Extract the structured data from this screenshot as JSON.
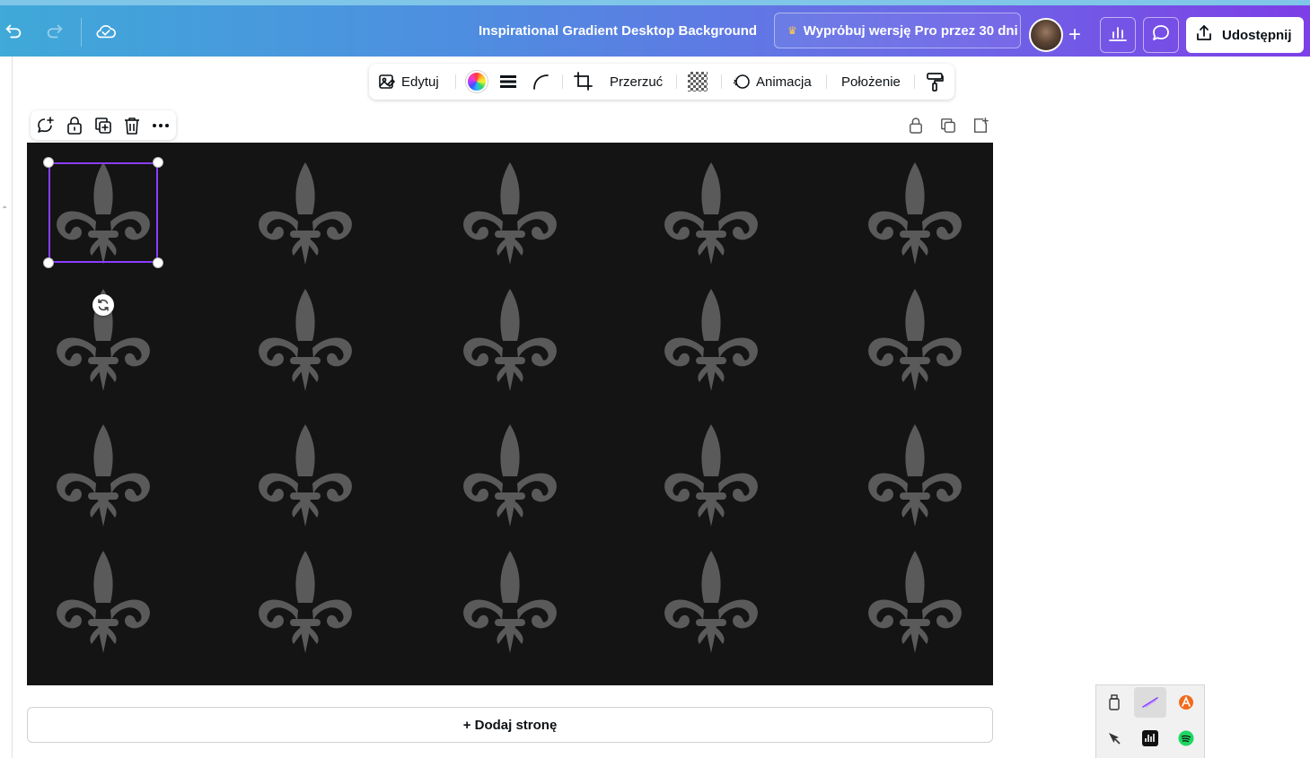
{
  "header": {
    "document_title": "Inspirational Gradient Desktop Background",
    "pro_cta_label": "Wyprόbuj wersję Pro przez 30 dni",
    "add_label": "+",
    "share_label": "Udostępnij",
    "icons": [
      "undo-icon",
      "redo-icon",
      "cloud-check-icon",
      "crown-icon",
      "bar-chart-icon",
      "comment-icon",
      "share-upload-icon"
    ]
  },
  "toolbar": {
    "edit_label": "Edytuj",
    "flip_label": "Przerzuć",
    "animate_label": "Animacja",
    "position_label": "Położenie",
    "icons": [
      "image-edit-icon",
      "color-wheel-icon",
      "line-weight-icon",
      "corner-rounding-icon",
      "crop-icon",
      "transparency-icon",
      "animation-icon",
      "paint-format-icon"
    ]
  },
  "element_actions": {
    "icons": [
      "comment-add-icon",
      "lock-icon",
      "duplicate-icon",
      "trash-icon",
      "more-icon"
    ]
  },
  "page_actions": {
    "icons": [
      "lock-icon",
      "duplicate-page-icon",
      "add-page-icon"
    ]
  },
  "canvas": {
    "background_color": "#141414",
    "motif": "fleur-de-lis",
    "motif_color": "#5a5a5a",
    "rows": 4,
    "columns": 5,
    "selection_color": "#8b3dff"
  },
  "add_page_label": "+ Dodaj stronę",
  "tray": {
    "icons": [
      "usb-drive-icon",
      "pen-app-icon",
      "avast-icon",
      "cursor-app-icon",
      "audio-app-icon",
      "spotify-icon"
    ]
  }
}
